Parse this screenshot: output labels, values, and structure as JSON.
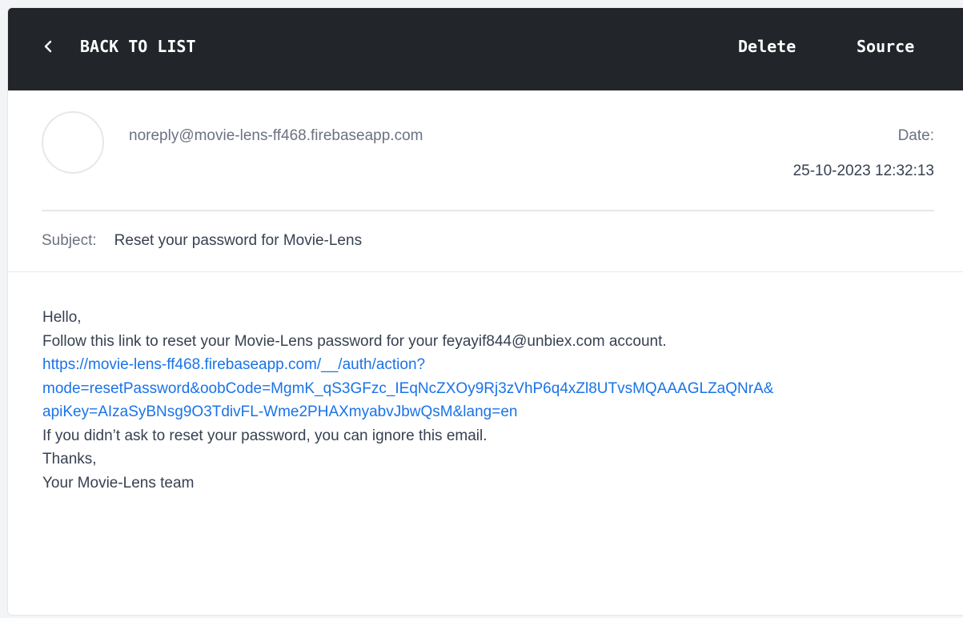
{
  "topbar": {
    "back_label": "BACK TO LIST",
    "delete_label": "Delete",
    "source_label": "Source",
    "background_color": "#22252a"
  },
  "email": {
    "sender": "noreply@movie-lens-ff468.firebaseapp.com",
    "date_label": "Date:",
    "date_value": "25-10-2023 12:32:13",
    "subject_label": "Subject:",
    "subject_value": "Reset your password for Movie-Lens",
    "body": {
      "greeting": "Hello,",
      "instruction": "Follow this link to reset your Movie-Lens password for your feyayif844@unbiex.com account.",
      "link_line1": "https://movie-lens-ff468.firebaseapp.com/__/auth/action?",
      "link_line2": "mode=resetPassword&oobCode=MgmK_qS3GFzc_IEqNcZXOy9Rj3zVhP6q4xZl8UTvsMQAAAGLZaQNrA&",
      "link_line3": "apiKey=AIzaSyBNsg9O3TdivFL-Wme2PHAXmyabvJbwQsM&lang=en",
      "ignore_note": "If you didn’t ask to reset your password, you can ignore this email.",
      "thanks": "Thanks,",
      "signature": "Your Movie-Lens team",
      "link_color": "#1a73e8"
    }
  }
}
